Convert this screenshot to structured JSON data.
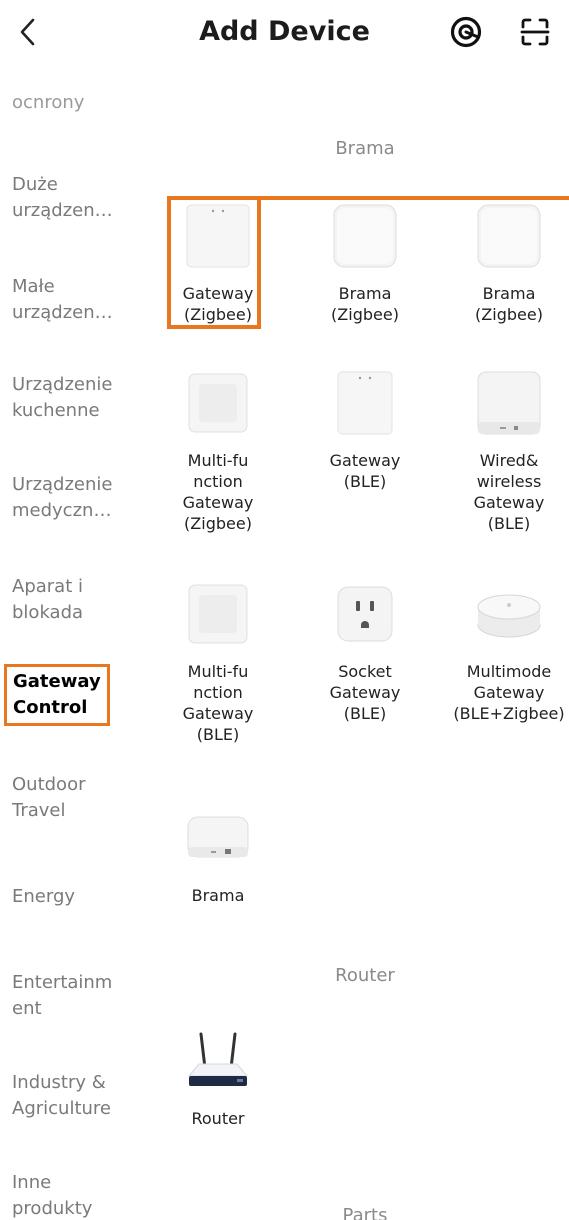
{
  "header": {
    "title": "Add Device"
  },
  "sidebar": {
    "partial_top": "ochrony",
    "items": [
      {
        "label": "Duże\nurządzen…"
      },
      {
        "label": "Małe\nurządzen…"
      },
      {
        "label": "Urządzenie\nkuchenne"
      },
      {
        "label": "Urządzenie\nmedyczn…"
      },
      {
        "label": "Aparat i\nblokada"
      },
      {
        "label": "Gateway\nControl"
      },
      {
        "label": "Outdoor\nTravel"
      },
      {
        "label": "Energy"
      },
      {
        "label": "Entertainm\nent"
      },
      {
        "label": "Industry &\nAgriculture"
      },
      {
        "label": "Inne\nprodukty"
      }
    ]
  },
  "sections": [
    {
      "title": "Brama",
      "devices": [
        {
          "label": "Gateway\n(Zigbee)"
        },
        {
          "label": "Brama\n(Zigbee)"
        },
        {
          "label": "Brama\n(Zigbee)"
        },
        {
          "label": "Multi-fu\nnction\nGateway\n(Zigbee)"
        },
        {
          "label": "Gateway\n(BLE)"
        },
        {
          "label": "Wired&\nwireless\nGateway\n(BLE)"
        },
        {
          "label": "Multi-fu\nnction\nGateway\n(BLE)"
        },
        {
          "label": "Socket\nGateway\n(BLE)"
        },
        {
          "label": "Multimode\nGateway\n(BLE+Zigbee)"
        },
        {
          "label": "Brama"
        }
      ]
    },
    {
      "title": "Router",
      "devices": [
        {
          "label": "Router"
        }
      ]
    },
    {
      "title": "Parts",
      "devices": []
    }
  ]
}
